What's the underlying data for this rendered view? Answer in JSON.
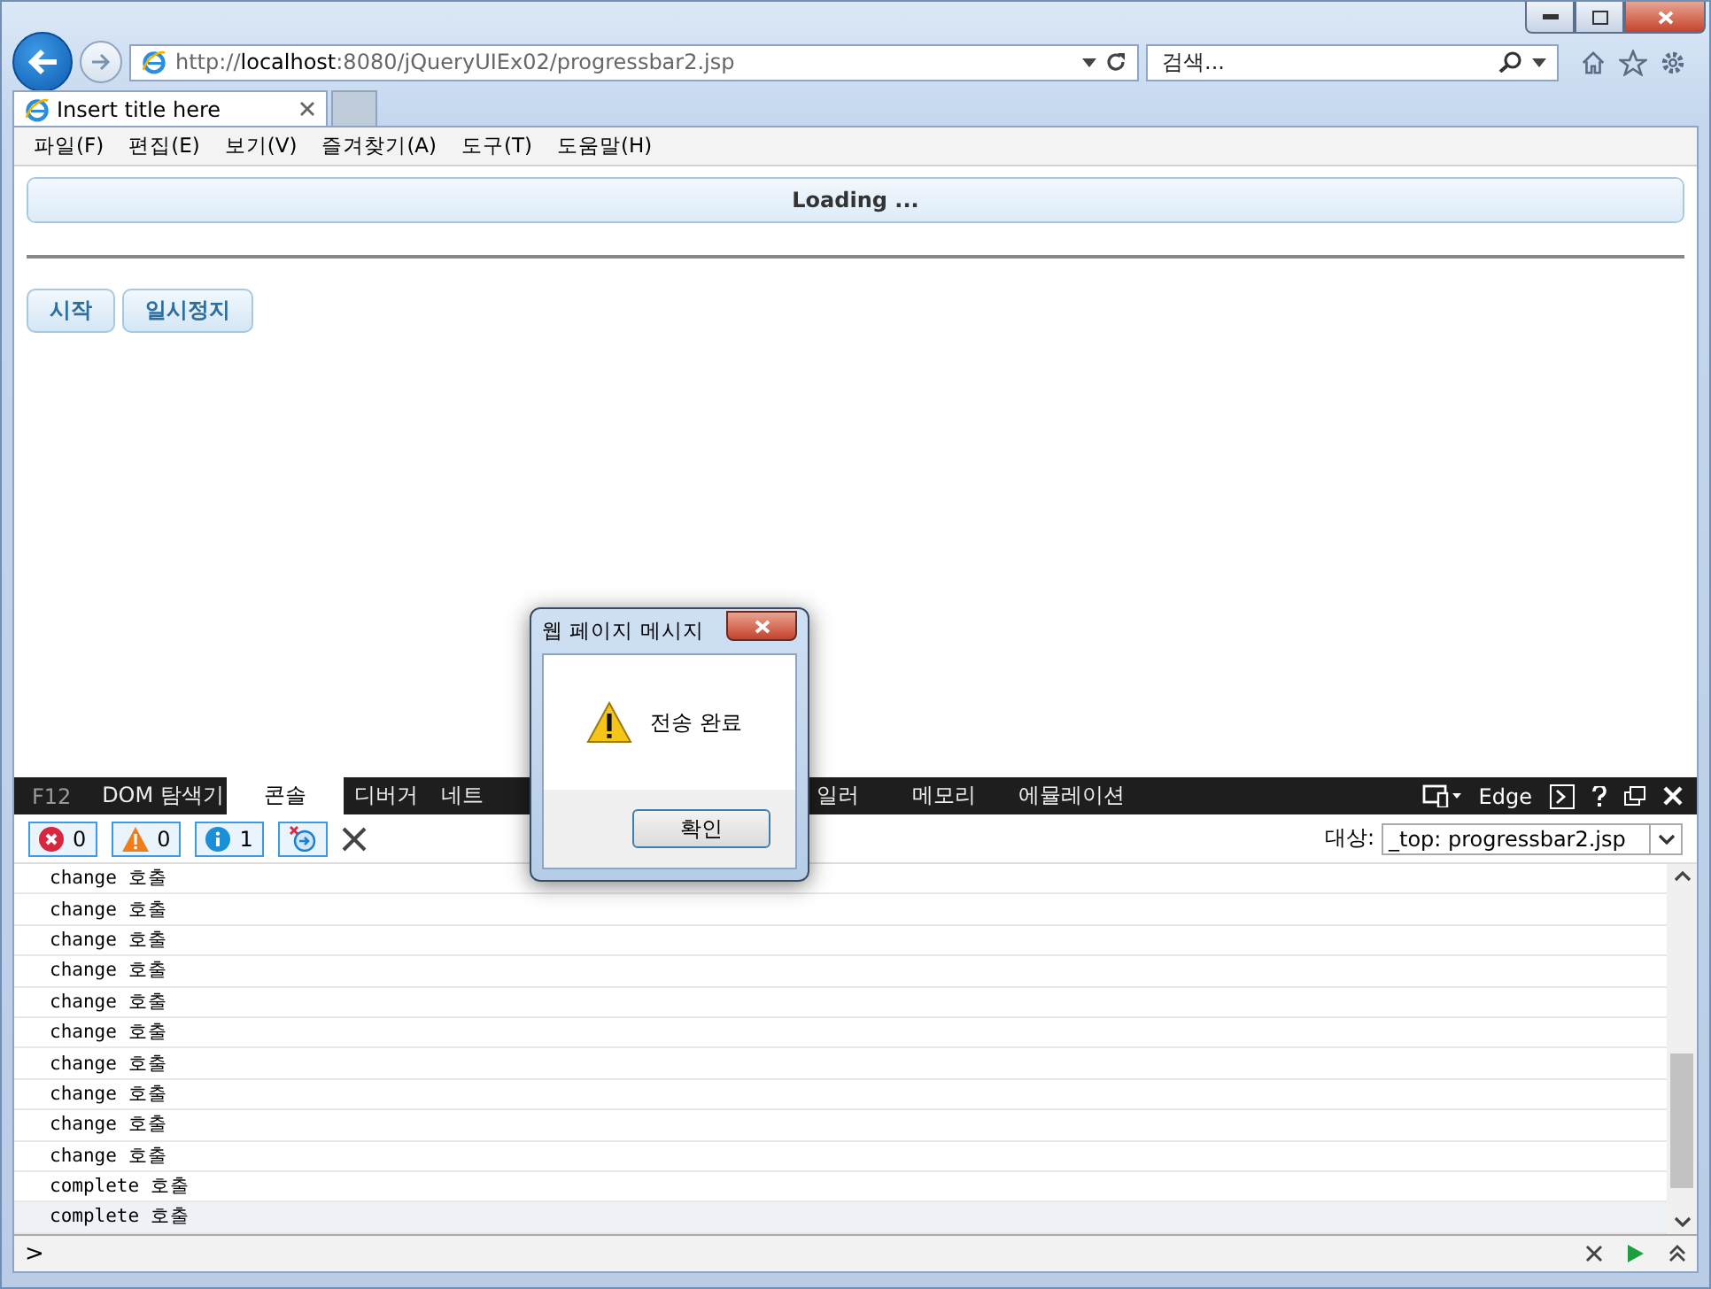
{
  "address_bar": {
    "url_prefix": "http://",
    "url_host": "localhost",
    "url_rest": ":8080/jQueryUIEx02/progressbar2.jsp"
  },
  "search": {
    "placeholder": "검색..."
  },
  "tabs": [
    {
      "label": "Insert title here",
      "selected": true
    }
  ],
  "menu": [
    "파일(F)",
    "편집(E)",
    "보기(V)",
    "즐겨찾기(A)",
    "도구(T)",
    "도움말(H)"
  ],
  "page": {
    "progress_label": "Loading ...",
    "level": 1,
    "buttons": [
      "시작",
      "일시정지"
    ]
  },
  "devtools": {
    "f12": "F12",
    "tabs": [
      {
        "label": "DOM 탐색기",
        "selected": false
      },
      {
        "label": "콘솔",
        "selected": true
      },
      {
        "label": "디버거",
        "selected": false
      },
      {
        "label": "네트",
        "selected": false
      },
      {
        "label": "일러",
        "selected": false
      },
      {
        "label": "메모리",
        "selected": false
      },
      {
        "label": "에뮬레이션",
        "selected": false
      }
    ],
    "mode": "Edge",
    "filters": [
      {
        "kind": "error",
        "count": "0",
        "on": true
      },
      {
        "kind": "warning",
        "count": "0",
        "on": true
      },
      {
        "kind": "info",
        "count": "1",
        "on": true
      }
    ],
    "target_label": "대상:",
    "target": "_top: progressbar2.jsp",
    "log": [
      {
        "text": "change 호출",
        "selected": false
      },
      {
        "text": "change 호출",
        "selected": false
      },
      {
        "text": "change 호출",
        "selected": false
      },
      {
        "text": "change 호출",
        "selected": false
      },
      {
        "text": "change 호출",
        "selected": false
      },
      {
        "text": "change 호출",
        "selected": false
      },
      {
        "text": "change 호출",
        "selected": false
      },
      {
        "text": "change 호출",
        "selected": false
      },
      {
        "text": "change 호출",
        "selected": false
      },
      {
        "text": "change 호출",
        "selected": false
      },
      {
        "text": "complete 호출",
        "selected": false
      },
      {
        "text": "complete 호출",
        "selected": true
      }
    ],
    "prompt": ">"
  },
  "dialog": {
    "title": "웹 페이지 메시지",
    "message": "전송 완료",
    "ok": "확인"
  }
}
